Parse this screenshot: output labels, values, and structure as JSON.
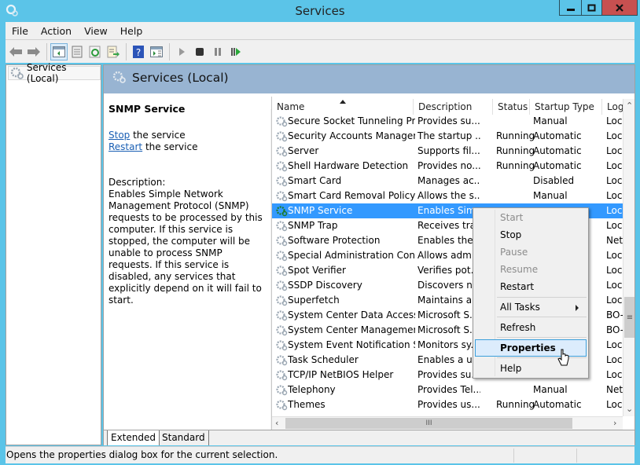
{
  "window": {
    "title": "Services",
    "controls": {
      "minimize": "minimize",
      "maximize": "maximize",
      "close": "close"
    },
    "accent_color": "#5bc4e8",
    "close_color": "#c75050"
  },
  "menubar": {
    "items": [
      "File",
      "Action",
      "View",
      "Help"
    ]
  },
  "toolbar": {
    "buttons": [
      {
        "icon": "back-arrow-icon"
      },
      {
        "icon": "forward-arrow-icon"
      },
      {
        "icon": "show-hide-console-tree-icon",
        "active": true
      },
      {
        "icon": "properties-icon"
      },
      {
        "icon": "refresh-icon"
      },
      {
        "icon": "export-list-icon"
      },
      {
        "icon": "help-icon"
      },
      {
        "icon": "show-hide-action-pane-icon"
      },
      {
        "icon": "start-service-icon"
      },
      {
        "icon": "stop-service-icon"
      },
      {
        "icon": "pause-service-icon"
      },
      {
        "icon": "restart-service-icon"
      }
    ]
  },
  "tree": {
    "items": [
      {
        "label": "Services (Local)",
        "icon": "services-gear-icon"
      }
    ]
  },
  "header": {
    "title": "Services (Local)",
    "band_color": "#98b4d2"
  },
  "extended": {
    "service_name": "SNMP Service",
    "stop_link": "Stop",
    "stop_suffix": " the service",
    "restart_link": "Restart",
    "restart_suffix": " the service",
    "description_label": "Description:",
    "description": "Enables Simple Network Management Protocol (SNMP) requests to be processed by this computer. If this service is stopped, the computer will be unable to process SNMP requests. If this service is disabled, any services that explicitly depend on it will fail to start."
  },
  "list": {
    "columns": [
      "Name",
      "Description",
      "Status",
      "Startup Type",
      "Log"
    ],
    "sorted_column": "Name",
    "selection_color": "#3399ff",
    "rows": [
      {
        "name": "Secure Socket Tunneling Pr...",
        "desc": "Provides su...",
        "status": "",
        "startup": "Manual",
        "logon": "Loc"
      },
      {
        "name": "Security Accounts Manager",
        "desc": "The startup ...",
        "status": "Running",
        "startup": "Automatic",
        "logon": "Loc"
      },
      {
        "name": "Server",
        "desc": "Supports fil...",
        "status": "Running",
        "startup": "Automatic",
        "logon": "Loc"
      },
      {
        "name": "Shell Hardware Detection",
        "desc": "Provides no...",
        "status": "Running",
        "startup": "Automatic",
        "logon": "Loc"
      },
      {
        "name": "Smart Card",
        "desc": "Manages ac...",
        "status": "",
        "startup": "Disabled",
        "logon": "Loc"
      },
      {
        "name": "Smart Card Removal Policy",
        "desc": "Allows the s...",
        "status": "",
        "startup": "Manual",
        "logon": "Loc"
      },
      {
        "name": "SNMP Service",
        "desc": "Enables Sim...",
        "status": "",
        "startup": "",
        "logon": "Loc",
        "selected": true
      },
      {
        "name": "SNMP Trap",
        "desc": "Receives tra...",
        "status": "",
        "startup": "",
        "logon": "Loc"
      },
      {
        "name": "Software Protection",
        "desc": "Enables the ...",
        "status": "",
        "startup": "",
        "logon": "Net"
      },
      {
        "name": "Special Administration Con...",
        "desc": "Allows adm...",
        "status": "",
        "startup": "",
        "logon": "Loc"
      },
      {
        "name": "Spot Verifier",
        "desc": "Verifies pot...",
        "status": "",
        "startup": "",
        "logon": "Loc"
      },
      {
        "name": "SSDP Discovery",
        "desc": "Discovers n...",
        "status": "",
        "startup": "",
        "logon": "Loc"
      },
      {
        "name": "Superfetch",
        "desc": "Maintains a...",
        "status": "",
        "startup": "",
        "logon": "Loc"
      },
      {
        "name": "System Center Data Access ...",
        "desc": "Microsoft S...",
        "status": "",
        "startup": "",
        "logon": "BO-"
      },
      {
        "name": "System Center Managemen...",
        "desc": "Microsoft S...",
        "status": "",
        "startup": "",
        "logon": "BO-"
      },
      {
        "name": "System Event Notification S...",
        "desc": "Monitors sy...",
        "status": "",
        "startup": "",
        "logon": "Loc"
      },
      {
        "name": "Task Scheduler",
        "desc": "Enables a us...",
        "status": "",
        "startup": "",
        "logon": "Loc"
      },
      {
        "name": "TCP/IP NetBIOS Helper",
        "desc": "Provides su...",
        "status": "",
        "startup": "",
        "logon": "Loc"
      },
      {
        "name": "Telephony",
        "desc": "Provides Tel...",
        "status": "",
        "startup": "Manual",
        "logon": "Net"
      },
      {
        "name": "Themes",
        "desc": "Provides us...",
        "status": "Running",
        "startup": "Automatic",
        "logon": "Loc"
      }
    ]
  },
  "context_menu": {
    "items": [
      {
        "label": "Start",
        "disabled": true
      },
      {
        "label": "Stop",
        "disabled": false
      },
      {
        "label": "Pause",
        "disabled": true
      },
      {
        "label": "Resume",
        "disabled": true
      },
      {
        "label": "Restart",
        "disabled": false
      },
      {
        "label": "All Tasks",
        "disabled": false,
        "submenu": true
      },
      {
        "label": "Refresh",
        "disabled": false
      },
      {
        "label": "Properties",
        "disabled": false,
        "highlighted": true
      },
      {
        "label": "Help",
        "disabled": false
      }
    ]
  },
  "tabs": {
    "items": [
      "Extended",
      "Standard"
    ],
    "active": "Extended"
  },
  "statusbar": {
    "text": "Opens the properties dialog box for the current selection."
  }
}
